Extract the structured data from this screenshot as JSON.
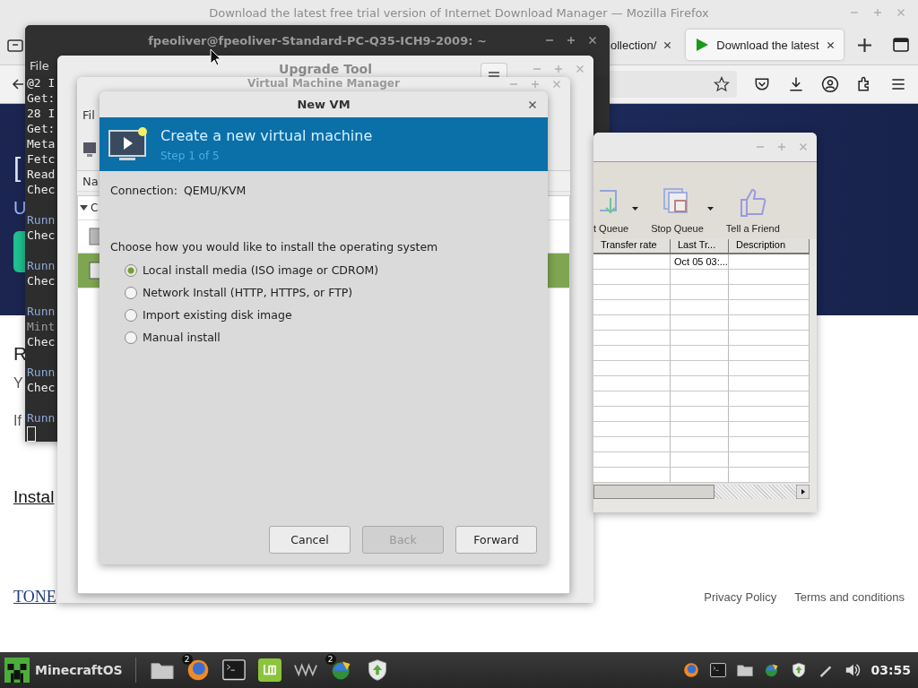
{
  "browser": {
    "title": "Download the latest free trial version of Internet Download Manager — Mozilla Firefox",
    "tabs": [
      {
        "label": "ollection/",
        "selected": false
      },
      {
        "label": "Download the latest",
        "selected": true
      }
    ],
    "page": {
      "banner_texts": [
        "[",
        "U"
      ],
      "texts": [
        "R",
        "Y",
        "If"
      ],
      "link": "Instal",
      "logo": "TONE",
      "footer_links": [
        "Privacy Policy",
        "Terms and conditions"
      ]
    }
  },
  "terminal": {
    "title": "fpeoliver@fpeoliver-Standard-PC-Q35-ICH9-2009: ~",
    "menu": [
      "File"
    ],
    "blocks": [
      {
        "lines": [
          {
            "text": "@2 I",
            "kind": "output"
          },
          {
            "text": "Get:",
            "kind": "output"
          },
          {
            "text": "28 I",
            "kind": "output"
          },
          {
            "text": "Get:",
            "kind": "output"
          },
          {
            "text": "Meta",
            "kind": "output"
          },
          {
            "text": "Fetc",
            "kind": "output"
          },
          {
            "text": "Read",
            "kind": "output"
          },
          {
            "text": "Chec",
            "kind": "output"
          }
        ]
      },
      {
        "lines": [
          {
            "text": "Runn",
            "kind": "status"
          },
          {
            "text": "Chec",
            "kind": "output"
          }
        ]
      },
      {
        "lines": [
          {
            "text": "Runn",
            "kind": "status"
          },
          {
            "text": "Chec",
            "kind": "output"
          }
        ]
      },
      {
        "lines": [
          {
            "text": "Runn",
            "kind": "status"
          },
          {
            "text": "Mint",
            "kind": "info"
          },
          {
            "text": "Chec",
            "kind": "output"
          }
        ]
      },
      {
        "lines": [
          {
            "text": "Runn",
            "kind": "status"
          },
          {
            "text": "Chec",
            "kind": "output"
          }
        ]
      },
      {
        "lines": [
          {
            "text": "Runn",
            "kind": "status"
          }
        ]
      }
    ]
  },
  "upgrade_tool": {
    "title": "Upgrade Tool"
  },
  "vm_manager": {
    "title": "Virtual Machine Manager",
    "menu": [
      "Fil"
    ],
    "column_1": "Na",
    "group": "C"
  },
  "idm": {
    "toolbar": [
      {
        "label": "t Queue",
        "kind": "start"
      },
      {
        "label": "Stop Queue",
        "kind": "stop"
      },
      {
        "label": "Tell a Friend",
        "kind": "like"
      }
    ],
    "columns": [
      "Transfer rate",
      "Last Tr...",
      "Description"
    ],
    "rows": [
      {
        "last_transfer": "Oct 05 03:..."
      }
    ]
  },
  "dialog": {
    "title": "New VM",
    "heading": "Create a new virtual machine",
    "step": "Step 1 of 5",
    "connection_label": "Connection:",
    "connection": "QEMU/KVM",
    "prompt": "Choose how you would like to install the operating system",
    "options": [
      {
        "label": "Local install media (ISO image or CDROM)",
        "selected": true
      },
      {
        "label": "Network Install (HTTP, HTTPS, or FTP)",
        "selected": false
      },
      {
        "label": "Import existing disk image",
        "selected": false
      },
      {
        "label": "Manual install",
        "selected": false
      }
    ],
    "buttons": [
      {
        "label": "Cancel",
        "disabled": false
      },
      {
        "label": "Back",
        "disabled": true
      },
      {
        "label": "Forward",
        "disabled": false
      }
    ]
  },
  "taskbar": {
    "menu_label": "MinecraftOS",
    "launchers": [
      {
        "kind": "folder"
      },
      {
        "kind": "firefox",
        "badge": "2"
      },
      {
        "kind": "terminal"
      },
      {
        "kind": "mint"
      },
      {
        "kind": "vm"
      },
      {
        "kind": "idm",
        "badge": "2"
      },
      {
        "kind": "shield"
      }
    ],
    "tray": [
      {
        "kind": "firefox"
      },
      {
        "kind": "terminal"
      },
      {
        "kind": "folder"
      },
      {
        "kind": "idm"
      },
      {
        "kind": "shield"
      },
      {
        "kind": "pen"
      },
      {
        "kind": "volume"
      }
    ],
    "clock": "03:55"
  }
}
